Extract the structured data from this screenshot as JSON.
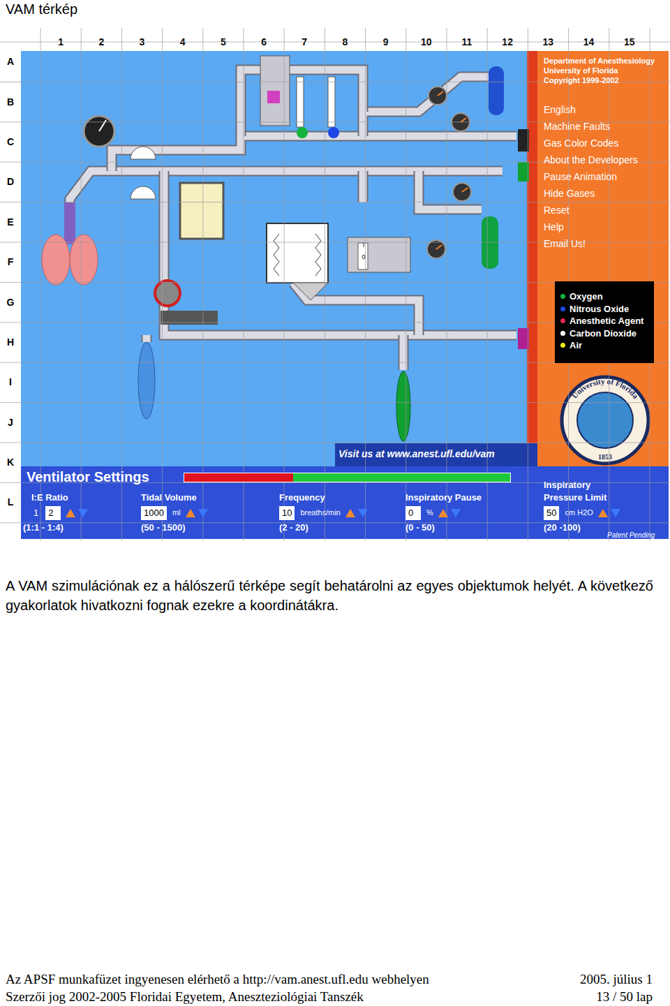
{
  "page": {
    "title": "VAM térkép"
  },
  "grid": {
    "columns": [
      "1",
      "2",
      "3",
      "4",
      "5",
      "6",
      "7",
      "8",
      "9",
      "10",
      "11",
      "12",
      "13",
      "14",
      "15"
    ],
    "rows": [
      "A",
      "B",
      "C",
      "D",
      "E",
      "F",
      "G",
      "H",
      "I",
      "J",
      "K",
      "L"
    ]
  },
  "simulator": {
    "header": [
      "Department of Anesthesiology",
      "University of Florida",
      "Copyright 1999-2002"
    ],
    "menu": [
      "English",
      "Machine Faults",
      "Gas Color Codes",
      "About the Developers",
      "Pause Animation",
      "Hide Gases",
      "Reset",
      "Help",
      "Email Us!"
    ],
    "legend": [
      {
        "label": "Oxygen",
        "color": "#14b43c"
      },
      {
        "label": "Nitrous Oxide",
        "color": "#1e46e6"
      },
      {
        "label": "Anesthetic Agent",
        "color": "#e8284c"
      },
      {
        "label": "Carbon Dioxide",
        "color": "#ffffff"
      },
      {
        "label": "Air",
        "color": "#f0e614"
      }
    ],
    "seal": {
      "top": "University of Florida",
      "year": "1853"
    },
    "vaporizer_dial": [
      "I",
      "0"
    ],
    "website": "Visit us at www.anest.ufl.edu/vam",
    "ventilator": {
      "title": "Ventilator Settings",
      "level": 0.335,
      "settings": [
        {
          "labels": [
            "I:E Ratio"
          ],
          "prefix": "1",
          "value": "2",
          "unit": "",
          "range": "(1:1 - 1:4)"
        },
        {
          "labels": [
            "Tidal Volume"
          ],
          "prefix": "",
          "value": "1000",
          "unit": "ml",
          "range": "(50 - 1500)"
        },
        {
          "labels": [
            "Frequency"
          ],
          "prefix": "",
          "value": "10",
          "unit": "breaths/min",
          "range": "(2 - 20)"
        },
        {
          "labels": [
            "Inspiratory Pause"
          ],
          "prefix": "",
          "value": "0",
          "unit": "%",
          "range": "(0 - 50)"
        },
        {
          "labels": [
            "Inspiratory",
            "Pressure Limit"
          ],
          "prefix": "",
          "value": "50",
          "unit": "cm H2O",
          "range": "(20 -100)"
        }
      ]
    },
    "patent": "Patent Pending"
  },
  "caption": "A VAM szimulációnak ez a hálószerű térképe segít behatárolni az egyes objektumok helyét. A következő gyakorlatok hivatkozni fognak ezekre a koordinátákra.",
  "footer": {
    "rows": [
      {
        "left": "Az APSF munkafüzet ingyenesen elérhető a http://vam.anest.ufl.edu webhelyen",
        "right": "2005. július 1"
      },
      {
        "left": "Szerzői jog 2002-2005 Floridai Egyetem, Aneszteziológiai Tanszék",
        "right": "13 / 50 lap"
      }
    ]
  }
}
